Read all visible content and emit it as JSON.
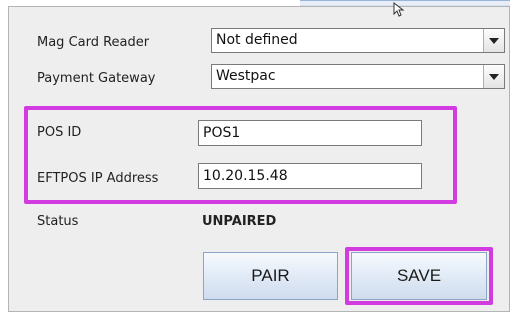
{
  "settings": {
    "mag_card_reader": {
      "label": "Mag Card Reader",
      "value": "Not defined"
    },
    "payment_gateway": {
      "label": "Payment Gateway",
      "value": "Westpac"
    },
    "pos_id": {
      "label": "POS ID",
      "value": "POS1"
    },
    "eftpos_ip": {
      "label": "EFTPOS IP Address",
      "value": "10.20.15.48"
    },
    "status": {
      "label": "Status",
      "value": "UNPAIRED"
    }
  },
  "buttons": {
    "pair": "PAIR",
    "save": "SAVE"
  },
  "colors": {
    "highlight": "#d13bdf",
    "panel": "#eeeeee",
    "button_border": "#8ea4c4"
  }
}
